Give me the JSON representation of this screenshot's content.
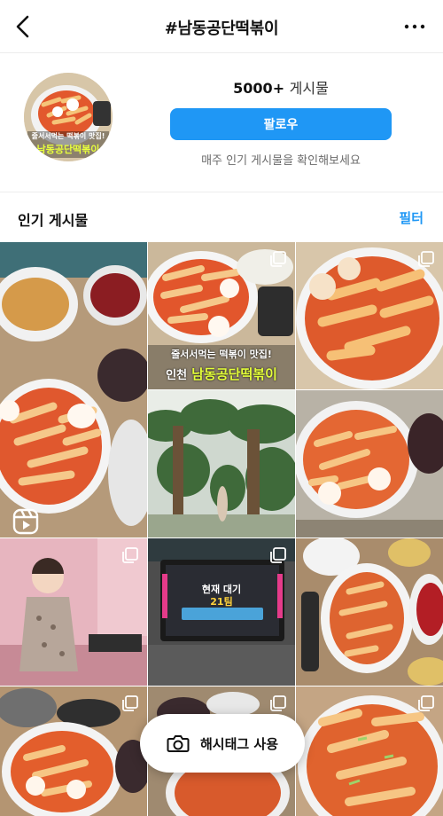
{
  "header": {
    "title": "#남동공단떡볶이",
    "back_icon": "chevron-left-icon",
    "more_icon": "more-horizontal-icon"
  },
  "profile": {
    "avatar_line1": "줄서서먹는 떡볶이 맛집!",
    "avatar_line2": "남동공단떡볶이",
    "post_count": "5000+",
    "post_unit": "게시물",
    "follow_label": "팔로우",
    "subtext": "매주 인기 게시물을 확인해보세요"
  },
  "section": {
    "title": "인기 게시물",
    "filter_label": "필터"
  },
  "posts": {
    "featured_caption_line1": "줄서서먹는 떡볶이 맛집!",
    "featured_caption_line2_prefix": "인천",
    "featured_caption_line2": "남동공단떡볶이",
    "kiosk_title": "현재 대기",
    "kiosk_number": "21팀"
  },
  "hashtag_button": {
    "label": "해시태그 사용",
    "icon": "camera-icon"
  },
  "colors": {
    "accent": "#1f97f5",
    "sauce": "#d9482b",
    "rice_cake": "#f3c889"
  }
}
